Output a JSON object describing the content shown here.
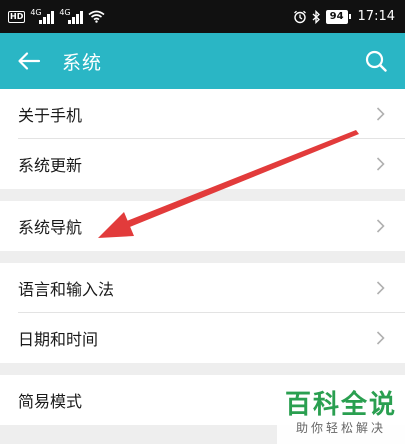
{
  "status_bar": {
    "hd_badge": "HD",
    "sim1_net": "4G",
    "sim2_net": "4G",
    "battery": "94",
    "time": "17:14"
  },
  "app_bar": {
    "title": "系统"
  },
  "groups": [
    {
      "items": [
        {
          "label": "关于手机"
        },
        {
          "label": "系统更新"
        }
      ]
    },
    {
      "items": [
        {
          "label": "系统导航"
        }
      ]
    },
    {
      "items": [
        {
          "label": "语言和输入法"
        },
        {
          "label": "日期和时间"
        }
      ]
    },
    {
      "items": [
        {
          "label": "简易模式"
        }
      ]
    }
  ],
  "annotation": {
    "arrow_color": "#e23b3b",
    "target": "系统导航"
  },
  "watermark": {
    "main": "百科全说",
    "sub": "助你轻松解决"
  },
  "colors": {
    "app_bar": "#2ab6c5",
    "status_bar": "#111111",
    "background": "#eeeeee",
    "watermark_green": "#2a9f50"
  }
}
